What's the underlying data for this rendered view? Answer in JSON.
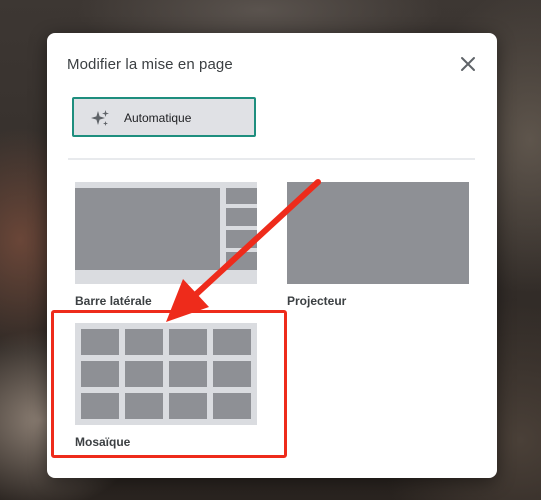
{
  "dialog": {
    "title": "Modifier la mise en page",
    "close_icon": "close-icon",
    "auto_option": {
      "label": "Automatique",
      "icon": "sparkle-icon",
      "selected": true
    },
    "layouts": [
      {
        "label": "Barre latérale",
        "icon": "sidebar-layout-thumbnail"
      },
      {
        "label": "Projecteur",
        "icon": "spotlight-layout-thumbnail"
      },
      {
        "label": "Mosaïque",
        "icon": "tiled-layout-thumbnail"
      }
    ]
  },
  "annotations": {
    "highlight_color": "#ee2b1b",
    "arrow_color": "#ee2b1b",
    "highlighted_option": "Mosaïque"
  },
  "colors": {
    "accent": "#1e8e7e",
    "thumb_background": "#dadce0",
    "thumb_tile": "#8e9095"
  }
}
